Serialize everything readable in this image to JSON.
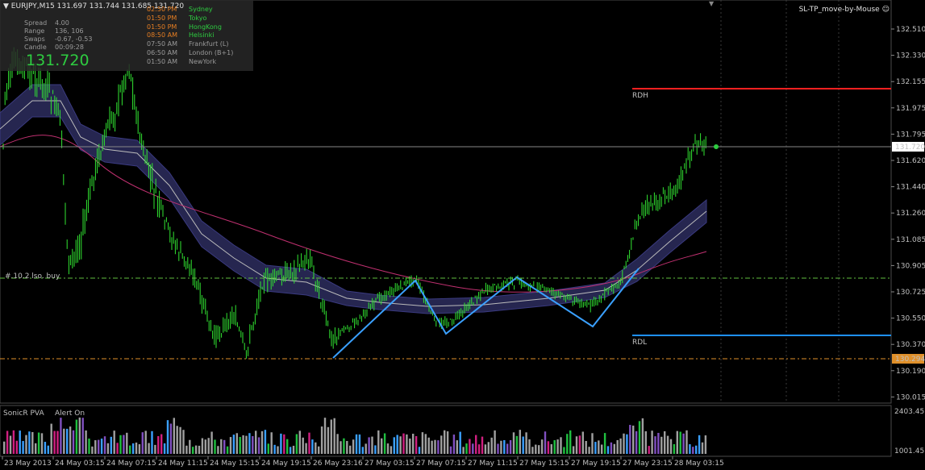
{
  "header": {
    "symbol_caption": "EURJPY,M15  131.697 131.744 131.685 131.720",
    "ea_name": "SL-TP_move-by-Mouse",
    "ea_icon": "smiley-icon"
  },
  "hud": {
    "stats": [
      {
        "label": "Spread",
        "value": "4.00"
      },
      {
        "label": "Range",
        "value": "136, 106"
      },
      {
        "label": "Swaps",
        "value": "-0.67, -0.53"
      },
      {
        "label": "Candle",
        "value": "00:09:28"
      }
    ],
    "big_price": "131.720",
    "sessions": [
      {
        "time": "02:50 PM",
        "name": "Sydney",
        "color": "#2ecc40",
        "time_color": "#e67e22"
      },
      {
        "time": "01:50 PM",
        "name": "Tokyo",
        "color": "#2ecc40",
        "time_color": "#e67e22"
      },
      {
        "time": "01:50 PM",
        "name": "HongKong",
        "color": "#2ecc40",
        "time_color": "#e67e22"
      },
      {
        "time": "08:50 AM",
        "name": "Helsinki",
        "color": "#2ecc40",
        "time_color": "#e67e22"
      },
      {
        "time": "07:50 AM",
        "name": "Frankfurt  (L)",
        "color": "#9a9a9a",
        "time_color": "#9a9a9a"
      },
      {
        "time": "06:50 AM",
        "name": "London  (B+1)",
        "color": "#9a9a9a",
        "time_color": "#9a9a9a"
      },
      {
        "time": "01:50 AM",
        "name": "NewYork",
        "color": "#9a9a9a",
        "time_color": "#9a9a9a"
      }
    ]
  },
  "levels": {
    "rdh_label": "RDH",
    "rdl_label": "RDL",
    "buy_label": "#.10.2 lso. buy",
    "current_price": "131.720",
    "buy_price_tag": "130.294"
  },
  "price_axis": [
    "132.510",
    "132.330",
    "132.155",
    "131.975",
    "131.795",
    "131.620",
    "131.440",
    "131.260",
    "131.085",
    "130.905",
    "130.725",
    "130.550",
    "130.370",
    "130.190",
    "130.015"
  ],
  "time_axis": [
    "23 May 2013",
    "24 May 03:15",
    "24 May 07:15",
    "24 May 11:15",
    "24 May 15:15",
    "24 May 19:15",
    "26 May 23:16",
    "27 May 03:15",
    "27 May 07:15",
    "27 May 11:15",
    "27 May 15:15",
    "27 May 19:15",
    "27 May 23:15",
    "28 May 03:15"
  ],
  "sub_window": {
    "title": "SonicR PVA",
    "alert": "Alert On",
    "axis_top": "2403.45",
    "axis_mid": "1001.45"
  },
  "colors": {
    "background": "#000000",
    "bull_candle": "#32e632",
    "rdh": "#ff2020",
    "rdl": "#1e90ff",
    "zigzag": "#3aa0ff",
    "band": "#2a2a5a",
    "ema_slow": "#c03070",
    "grid": "#2a2a2a"
  }
}
